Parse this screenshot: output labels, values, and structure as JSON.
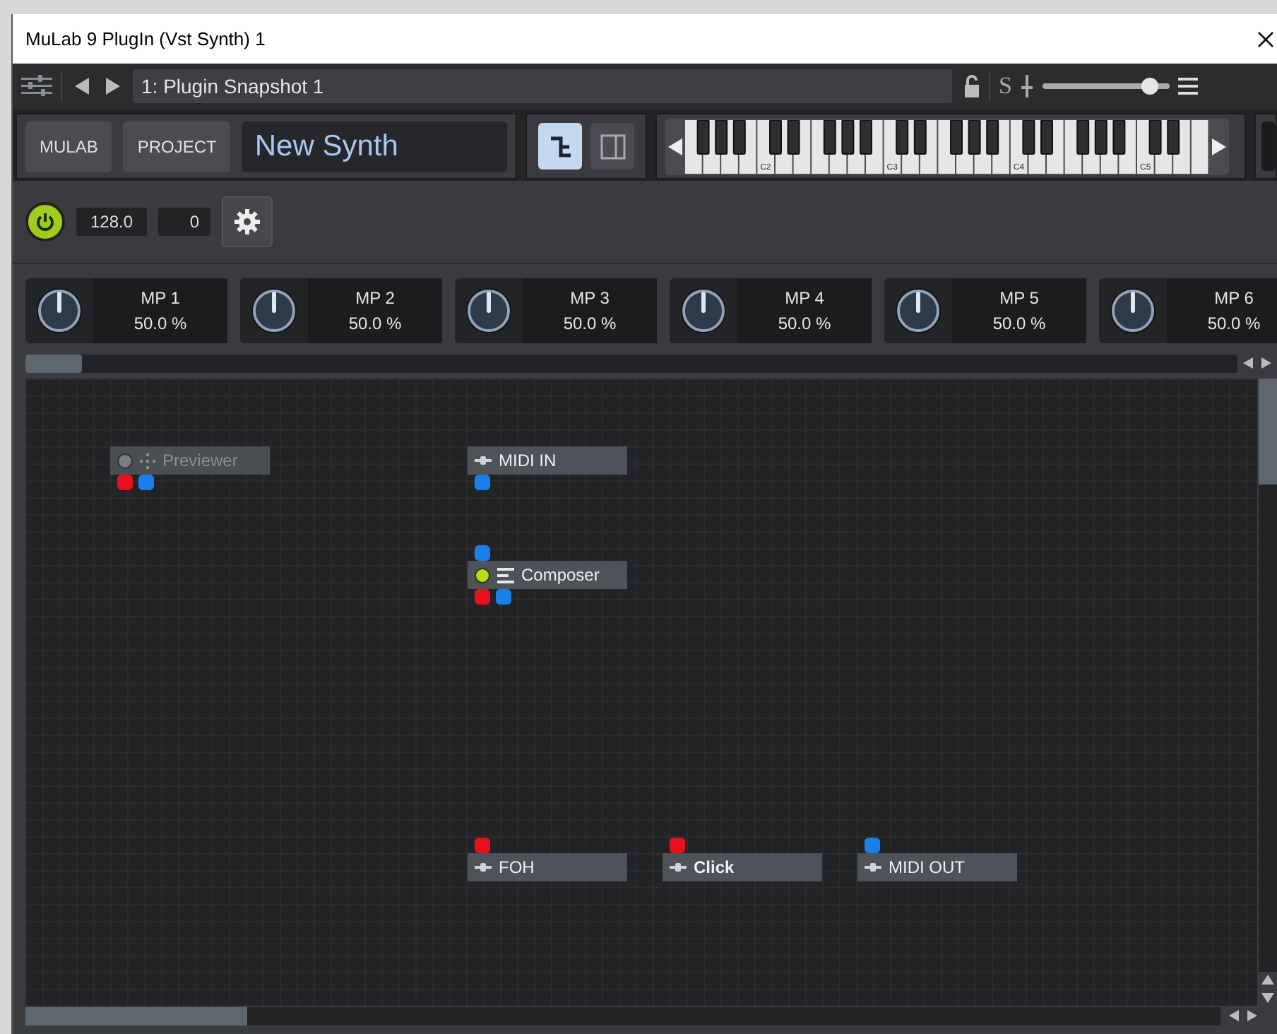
{
  "window": {
    "title": "MuLab 9 PlugIn (Vst Synth) 1"
  },
  "toolbar": {
    "preset": "1: Plugin Snapshot 1",
    "solo_label": "S",
    "volume": {
      "level": 0.84
    }
  },
  "header": {
    "buttons": [
      "MULAB",
      "PROJECT"
    ],
    "synth_name": "New Synth",
    "view_buttons": [
      {
        "kind": "graph",
        "selected": true
      },
      {
        "kind": "panel",
        "selected": false
      }
    ],
    "keyboard": {
      "octave_labels": [
        "C2",
        "C3",
        "C4",
        "C5"
      ]
    }
  },
  "controls": {
    "power": {
      "on": true
    },
    "tempo": "128.0",
    "transpose": "0"
  },
  "macro_params": [
    {
      "name": "MP 1",
      "value": "50.0 %"
    },
    {
      "name": "MP 2",
      "value": "50.0 %"
    },
    {
      "name": "MP 3",
      "value": "50.0 %"
    },
    {
      "name": "MP 4",
      "value": "50.0 %"
    },
    {
      "name": "MP 5",
      "value": "50.0 %"
    },
    {
      "name": "MP 6",
      "value": "50.0 %"
    }
  ],
  "nodes": [
    {
      "name": "Previewer",
      "kind": "move",
      "has_led": true,
      "led_on": false,
      "disabled": true,
      "bold": false,
      "outputs": [
        {
          "kind": "audio"
        },
        {
          "kind": "midi"
        }
      ]
    },
    {
      "name": "MIDI IN",
      "kind": "io",
      "has_led": false,
      "disabled": false,
      "bold": false,
      "outputs": [
        {
          "kind": "midi"
        }
      ]
    },
    {
      "name": "Composer",
      "kind": "list",
      "has_led": true,
      "led_on": true,
      "disabled": false,
      "bold": false,
      "inputs": [
        {
          "kind": "midi"
        }
      ],
      "outputs": [
        {
          "kind": "audio"
        },
        {
          "kind": "midi"
        }
      ]
    },
    {
      "name": "FOH",
      "kind": "io",
      "has_led": false,
      "disabled": false,
      "bold": false,
      "inputs": [
        {
          "kind": "audio"
        }
      ]
    },
    {
      "name": "Click",
      "kind": "io",
      "has_led": false,
      "disabled": false,
      "bold": true,
      "inputs": [
        {
          "kind": "audio"
        }
      ]
    },
    {
      "name": "MIDI OUT",
      "kind": "io",
      "has_led": false,
      "disabled": false,
      "bold": false,
      "inputs": [
        {
          "kind": "midi"
        }
      ]
    }
  ]
}
